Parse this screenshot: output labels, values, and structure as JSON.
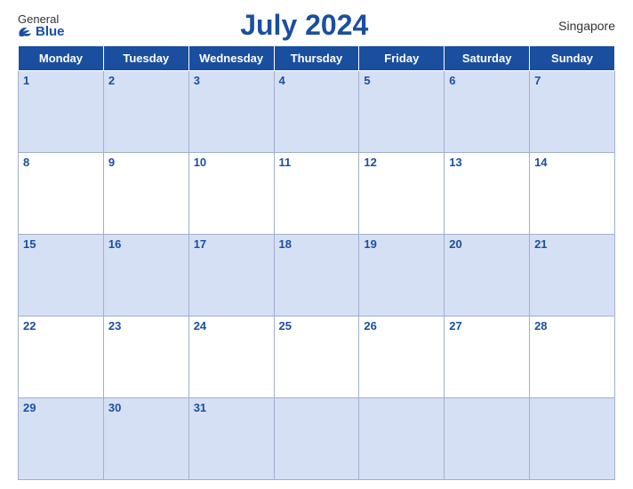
{
  "logo": {
    "general": "General",
    "blue": "Blue"
  },
  "title": "July 2024",
  "region": "Singapore",
  "weekdays": [
    "Monday",
    "Tuesday",
    "Wednesday",
    "Thursday",
    "Friday",
    "Saturday",
    "Sunday"
  ],
  "weeks": [
    [
      {
        "day": 1
      },
      {
        "day": 2
      },
      {
        "day": 3
      },
      {
        "day": 4
      },
      {
        "day": 5
      },
      {
        "day": 6
      },
      {
        "day": 7
      }
    ],
    [
      {
        "day": 8
      },
      {
        "day": 9
      },
      {
        "day": 10
      },
      {
        "day": 11
      },
      {
        "day": 12
      },
      {
        "day": 13
      },
      {
        "day": 14
      }
    ],
    [
      {
        "day": 15
      },
      {
        "day": 16
      },
      {
        "day": 17
      },
      {
        "day": 18
      },
      {
        "day": 19
      },
      {
        "day": 20
      },
      {
        "day": 21
      }
    ],
    [
      {
        "day": 22
      },
      {
        "day": 23
      },
      {
        "day": 24
      },
      {
        "day": 25
      },
      {
        "day": 26
      },
      {
        "day": 27
      },
      {
        "day": 28
      }
    ],
    [
      {
        "day": 29
      },
      {
        "day": 30
      },
      {
        "day": 31
      },
      {
        "day": null
      },
      {
        "day": null
      },
      {
        "day": null
      },
      {
        "day": null
      }
    ]
  ]
}
